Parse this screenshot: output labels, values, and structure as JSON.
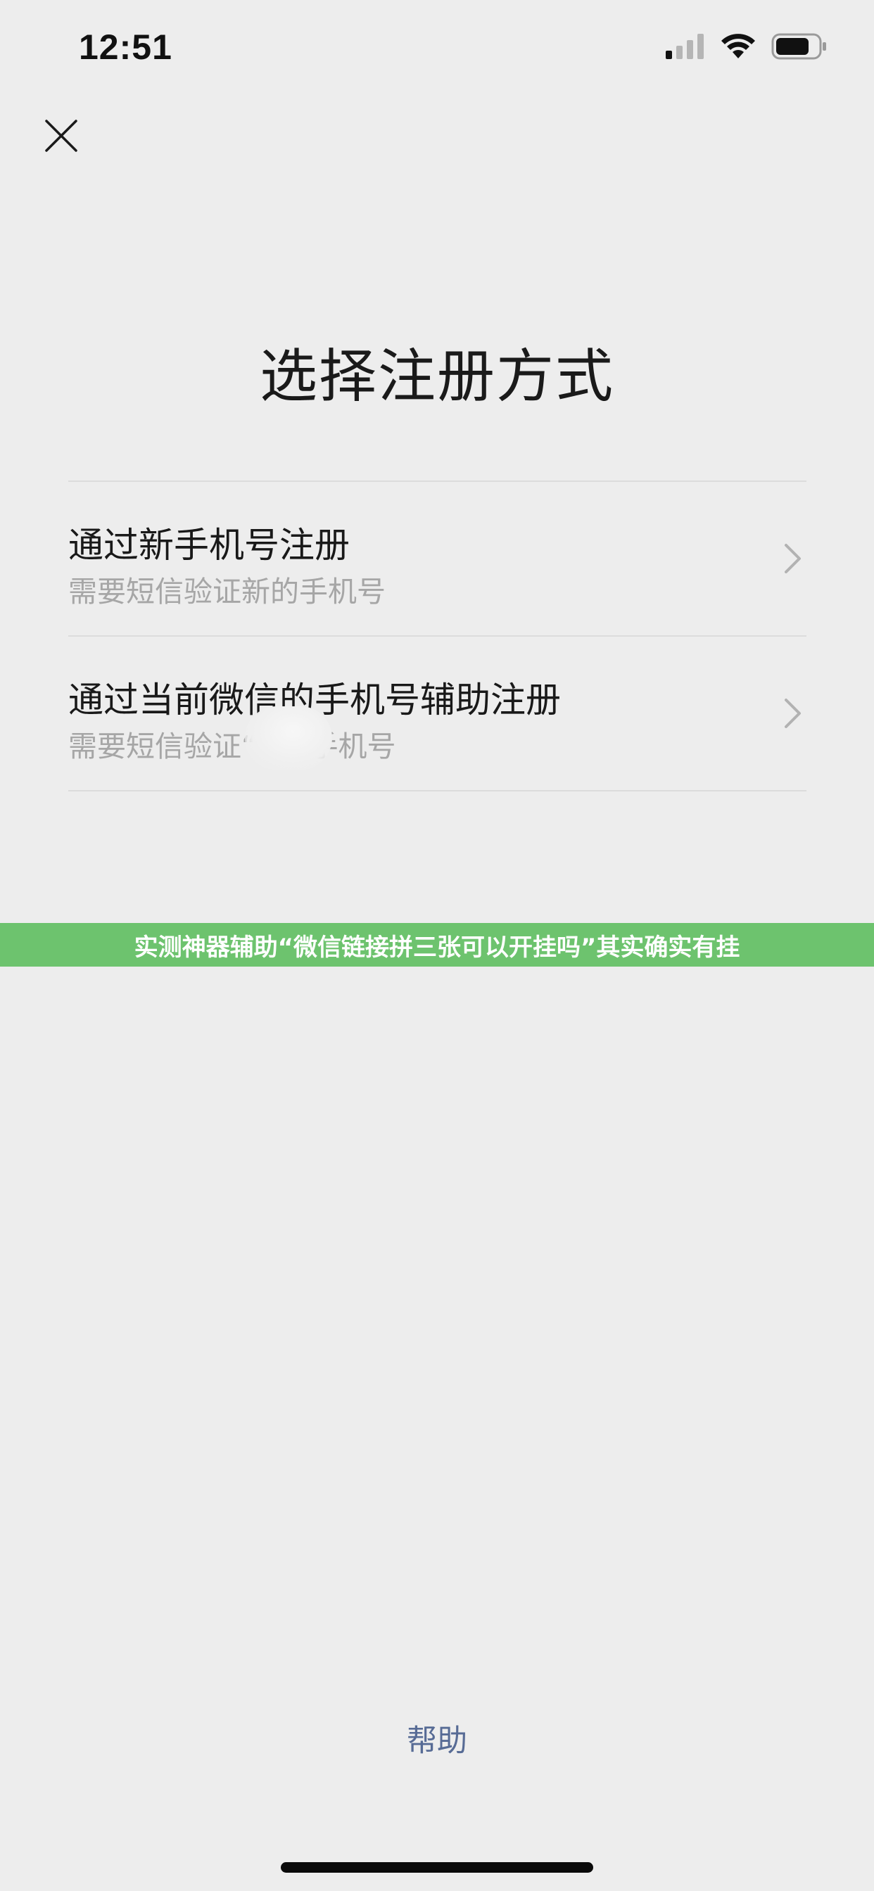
{
  "status_bar": {
    "time": "12:51",
    "signal_icon": "cellular-signal-icon",
    "wifi_icon": "wifi-icon",
    "battery_icon": "battery-icon"
  },
  "nav": {
    "close_icon": "close-icon"
  },
  "page": {
    "title": "选择注册方式"
  },
  "options": [
    {
      "title": "通过新手机号注册",
      "description": "需要短信验证新的手机号",
      "chevron_icon": "chevron-right-icon"
    },
    {
      "title": "通过当前微信的手机号辅助注册",
      "description": "需要短信验证“      ”的手机号",
      "chevron_icon": "chevron-right-icon"
    }
  ],
  "banner": {
    "text": "实测神器辅助“微信链接拼三张可以开挂吗”其实确实有挂",
    "color": "#6DC36E"
  },
  "footer": {
    "help_label": "帮助",
    "link_color": "#576B95"
  }
}
